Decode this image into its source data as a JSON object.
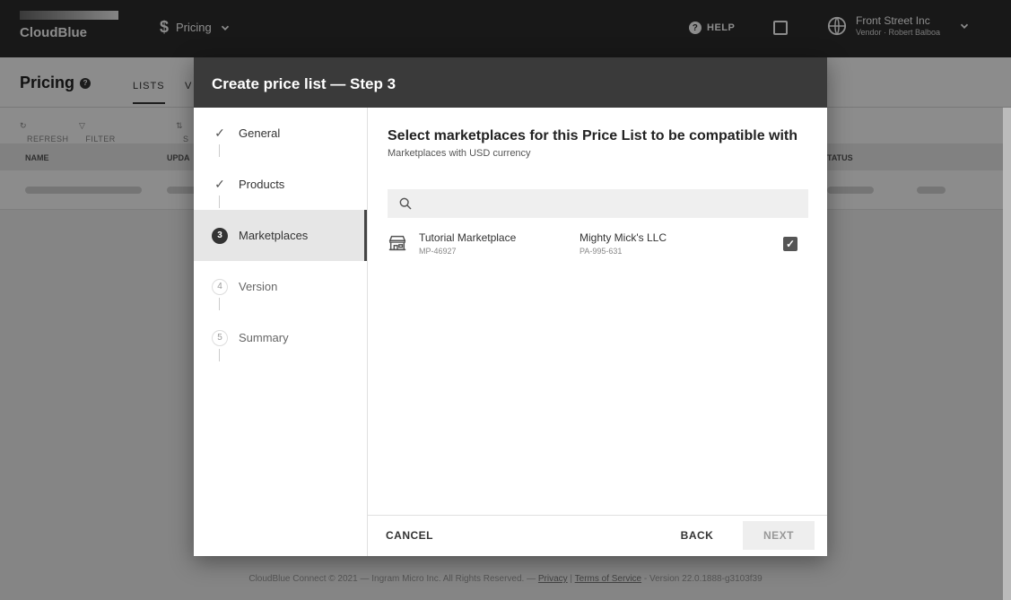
{
  "topbar": {
    "logo_text": "CloudBlue",
    "module_label": "Pricing",
    "help_label": "HELP",
    "account_name": "Front Street Inc",
    "account_role": "Vendor · Robert Balboa"
  },
  "page": {
    "title": "Pricing",
    "tabs": [
      "LISTS",
      "V"
    ],
    "toolbar": [
      "REFRESH",
      "FILTER",
      "S"
    ],
    "columns": [
      "NAME",
      "UPDA",
      "TATUS"
    ]
  },
  "dialog": {
    "title": "Create price list — Step 3",
    "steps": [
      {
        "number": "✓",
        "label": "General",
        "state": "done"
      },
      {
        "number": "✓",
        "label": "Products",
        "state": "done"
      },
      {
        "number": "3",
        "label": "Marketplaces",
        "state": "active"
      },
      {
        "number": "4",
        "label": "Version",
        "state": "pending"
      },
      {
        "number": "5",
        "label": "Summary",
        "state": "pending"
      }
    ],
    "heading": "Select marketplaces for this Price List to be compatible with",
    "subheading": "Marketplaces with USD currency",
    "search_placeholder": "",
    "marketplaces": [
      {
        "name": "Tutorial Marketplace",
        "id": "MP-46927",
        "owner": "Mighty Mick's LLC",
        "owner_id": "PA-995-631",
        "checked": true
      }
    ],
    "buttons": {
      "cancel": "CANCEL",
      "back": "BACK",
      "next": "NEXT"
    }
  },
  "footer": {
    "text": "CloudBlue Connect © 2021 — Ingram Micro Inc. All Rights Reserved. — ",
    "privacy": "Privacy",
    "sep": " | ",
    "terms": "Terms of Service",
    "version": " - Version 22.0.1888-g3103f39"
  }
}
